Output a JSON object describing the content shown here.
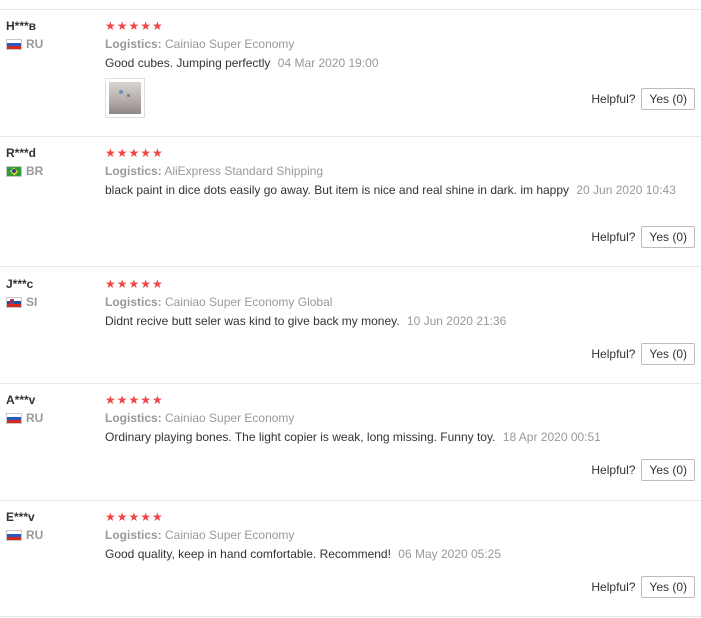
{
  "helpful_label": "Helpful?",
  "colors": {
    "star": "#f04645",
    "muted": "#999999",
    "text": "#333333"
  },
  "reviews": [
    {
      "user": "H***в",
      "country": "RU",
      "flag": "russia-flag-icon",
      "stars": "★★★★★",
      "logistics_label": "Logistics:",
      "logistics": "Cainiao Super Economy",
      "text": "Good cubes. Jumping perfectly",
      "date": "04 Mar 2020 19:00",
      "has_photo": true,
      "helpful_button": "Yes (0)"
    },
    {
      "user": "R***d",
      "country": "BR",
      "flag": "brazil-flag-icon",
      "stars": "★★★★★",
      "logistics_label": "Logistics:",
      "logistics": "AliExpress Standard Shipping",
      "text": "black paint in dice dots easily go away. But item is nice and real shine in dark. im happy",
      "date": "20 Jun 2020 10:43",
      "has_photo": false,
      "helpful_button": "Yes (0)"
    },
    {
      "user": "J***c",
      "country": "SI",
      "flag": "slovenia-flag-icon",
      "stars": "★★★★★",
      "logistics_label": "Logistics:",
      "logistics": "Cainiao Super Economy Global",
      "text": "Didnt recive butt seler was kind to give back my money.",
      "date": "10 Jun 2020 21:36",
      "has_photo": false,
      "helpful_button": "Yes (0)"
    },
    {
      "user": "A***v",
      "country": "RU",
      "flag": "russia-flag-icon",
      "stars": "★★★★★",
      "logistics_label": "Logistics:",
      "logistics": "Cainiao Super Economy",
      "text": "Ordinary playing bones. The light copier is weak, long missing. Funny toy.",
      "date": "18 Apr 2020 00:51",
      "has_photo": false,
      "helpful_button": "Yes (0)"
    },
    {
      "user": "E***v",
      "country": "RU",
      "flag": "russia-flag-icon",
      "stars": "★★★★★",
      "logistics_label": "Logistics:",
      "logistics": "Cainiao Super Economy",
      "text": "Good quality, keep in hand comfortable. Recommend!",
      "date": "06 May 2020 05:25",
      "has_photo": false,
      "helpful_button": "Yes (0)"
    }
  ]
}
